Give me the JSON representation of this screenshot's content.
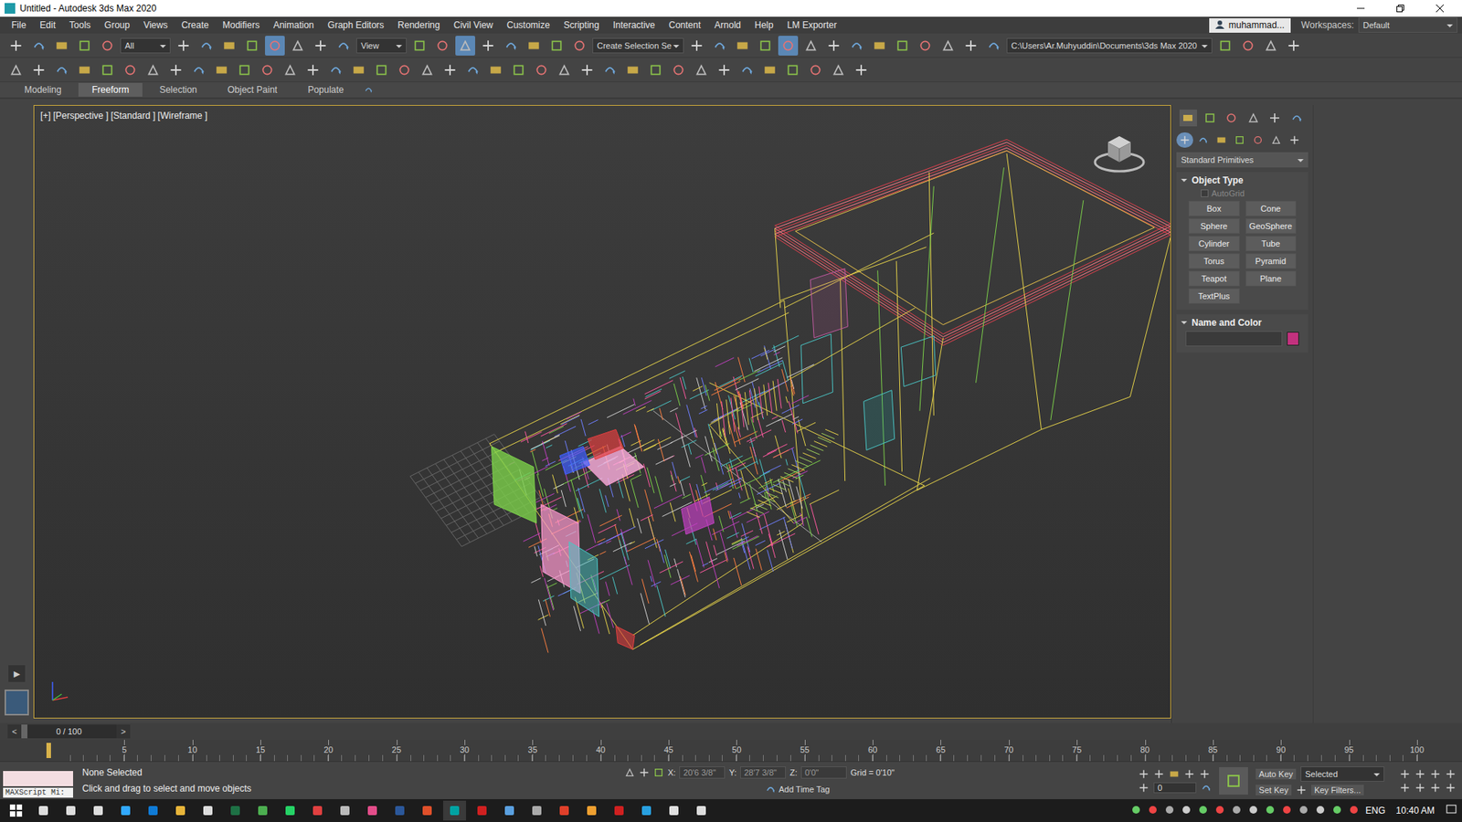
{
  "window": {
    "title": "Untitled - Autodesk 3ds Max 2020"
  },
  "menu": [
    "File",
    "Edit",
    "Tools",
    "Group",
    "Views",
    "Create",
    "Modifiers",
    "Animation",
    "Graph Editors",
    "Rendering",
    "Civil View",
    "Customize",
    "Scripting",
    "Interactive",
    "Content",
    "Arnold",
    "Help",
    "LM Exporter"
  ],
  "user": "muhammad...",
  "workspaces": {
    "label": "Workspaces:",
    "value": "Default"
  },
  "toolbar": [
    {
      "kind": "tool",
      "selected": false
    },
    {
      "kind": "tool",
      "selected": false
    },
    {
      "kind": "tool",
      "selected": false
    },
    {
      "kind": "tool",
      "selected": false
    },
    {
      "kind": "tool",
      "selected": false
    },
    {
      "kind": "dropdown",
      "value": "All"
    },
    {
      "kind": "tool",
      "selected": false
    },
    {
      "kind": "tool",
      "selected": false
    },
    {
      "kind": "tool",
      "selected": false
    },
    {
      "kind": "tool",
      "selected": false
    },
    {
      "kind": "tool",
      "selected": true
    },
    {
      "kind": "tool",
      "selected": false
    },
    {
      "kind": "tool",
      "selected": false
    },
    {
      "kind": "tool",
      "selected": false
    },
    {
      "kind": "dropdown",
      "value": "View"
    },
    {
      "kind": "tool",
      "selected": false
    },
    {
      "kind": "tool",
      "selected": false
    },
    {
      "kind": "tool",
      "selected": true
    },
    {
      "kind": "tool",
      "selected": false
    },
    {
      "kind": "tool",
      "selected": false
    },
    {
      "kind": "tool",
      "selected": false
    },
    {
      "kind": "tool",
      "selected": false
    },
    {
      "kind": "tool",
      "selected": false
    },
    {
      "kind": "dropdown",
      "value": "Create Selection Se"
    },
    {
      "kind": "tool",
      "selected": false
    },
    {
      "kind": "tool",
      "selected": false
    },
    {
      "kind": "tool",
      "selected": false
    },
    {
      "kind": "tool",
      "selected": false
    },
    {
      "kind": "tool",
      "selected": true
    },
    {
      "kind": "tool",
      "selected": false
    },
    {
      "kind": "tool",
      "selected": false
    },
    {
      "kind": "tool",
      "selected": false
    },
    {
      "kind": "tool",
      "selected": false
    },
    {
      "kind": "tool",
      "selected": false
    },
    {
      "kind": "tool",
      "selected": false
    },
    {
      "kind": "tool",
      "selected": false
    },
    {
      "kind": "tool",
      "selected": false
    },
    {
      "kind": "tool",
      "selected": false
    },
    {
      "kind": "dropdown",
      "value": "C:\\Users\\Ar.Muhyuddin\\Documents\\3ds Max 2020"
    },
    {
      "kind": "tool",
      "selected": false
    },
    {
      "kind": "tool",
      "selected": false
    },
    {
      "kind": "tool",
      "selected": false
    },
    {
      "kind": "tool",
      "selected": false
    }
  ],
  "ribbon_tabs": [
    {
      "label": "Modeling",
      "selected": false
    },
    {
      "label": "Freeform",
      "selected": true
    },
    {
      "label": "Selection",
      "selected": false
    },
    {
      "label": "Object Paint",
      "selected": false
    },
    {
      "label": "Populate",
      "selected": false
    }
  ],
  "viewport": {
    "labels": [
      "[+]",
      "[Perspective ]",
      "[Standard ]",
      "[Wireframe ]"
    ],
    "active": true
  },
  "side_button": "▶",
  "command_panel": {
    "tabs": [
      {
        "selected": true
      },
      {
        "selected": false
      },
      {
        "selected": false
      },
      {
        "selected": false
      },
      {
        "selected": false
      },
      {
        "selected": false
      }
    ],
    "categories": [
      {
        "selected": true
      },
      {
        "selected": false
      },
      {
        "selected": false
      },
      {
        "selected": false
      },
      {
        "selected": false
      },
      {
        "selected": false
      },
      {
        "selected": false
      }
    ],
    "category_dropdown": "Standard Primitives",
    "object_type": {
      "title": "Object Type",
      "autogrid": {
        "label": "AutoGrid",
        "checked": false,
        "disabled": true
      },
      "buttons": [
        "Box",
        "Cone",
        "Sphere",
        "GeoSphere",
        "Cylinder",
        "Tube",
        "Torus",
        "Pyramid",
        "Teapot",
        "Plane",
        "TextPlus"
      ]
    },
    "name_and_color": {
      "title": "Name and Color",
      "name": "",
      "color": "#c2317e"
    }
  },
  "timeline": {
    "prev": "<",
    "next": ">",
    "frame": "0 / 100",
    "level": 0,
    "ticks": [
      "5",
      "10",
      "15",
      "20",
      "25",
      "30",
      "35",
      "40",
      "45",
      "50",
      "55",
      "60",
      "65",
      "70",
      "75",
      "80",
      "85",
      "90",
      "95",
      "100"
    ]
  },
  "status": {
    "maxscript": "MAXScript Mi:",
    "selection": "None Selected",
    "prompt": "Click and drag to select and move objects",
    "x_label": "X:",
    "x": "20'6 3/8\"",
    "y_label": "Y:",
    "y": "28'7 3/8\"",
    "z_label": "Z:",
    "z": "0'0\"",
    "grid": "Grid = 0'10\"",
    "time_tag": "Add Time Tag",
    "auto_key": "Auto Key",
    "set_key_filter": "Selected",
    "set_key": "Set Key",
    "key_filters": "Key Filters...",
    "current_frame": "0"
  },
  "taskbar": {
    "language": "ENG",
    "time": "10:40 AM"
  }
}
